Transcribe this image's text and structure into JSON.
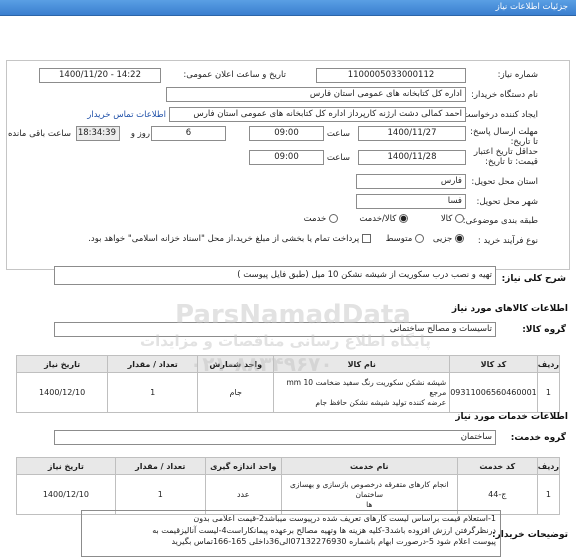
{
  "header": {
    "title": "جزئیات اطلاعات نیاز"
  },
  "form": {
    "need_number_label": "شماره نیاز:",
    "need_number": "1100005033000112",
    "announce_label": "تاریخ و ساعت اعلان عمومی:",
    "announce_value": "1400/11/20 - 14:22",
    "buyer_org_label": "نام دستگاه خریدار:",
    "buyer_org": "اداره کل کتابخانه های عمومی استان فارس",
    "creator_label": "ایجاد کننده درخواست:",
    "creator": "احمد  کمالی دشت ارژنه  کارپرداز اداره کل کتابخانه های عمومی استان فارس",
    "contact_link": "اطلاعات تماس خریدار",
    "deadline_label": "مهلت ارسال پاسخ: تا تاریخ:",
    "deadline_date": "1400/11/27",
    "time_label": "ساعت",
    "deadline_time": "09:00",
    "days": "6",
    "days_label": "روز و",
    "remaining_time": "18:34:39",
    "remaining_label": "ساعت باقی مانده",
    "price_valid_label": "حداقل تاریخ اعتبار قیمت: تا تاریخ:",
    "price_valid_date": "1400/11/28",
    "price_valid_time": "09:00",
    "province_label": "استان محل تحویل:",
    "province": "فارس",
    "city_label": "شهر محل تحویل:",
    "city": "فسا",
    "category_label": "طبقه بندی موضوعی:",
    "category_options": [
      "کالا",
      "کالا/خدمت",
      "خدمت"
    ],
    "purchase_label": "نوع فرآیند خرید :",
    "purchase_options": [
      "جزیی",
      "متوسط"
    ],
    "payment_note": "پرداخت تمام یا بخشی از مبلغ خرید،از محل \"اسناد خزانه اسلامی\" خواهد بود."
  },
  "summary": {
    "label": "شرح کلی نیاز:",
    "value": "تهیه و نصب درب سکوریت از شیشه نشکن 10 میل (طبق فایل پیوست )"
  },
  "goods": {
    "section_title": "اطلاعات کالاهای مورد نیاز",
    "group_label": "گروه کالا:",
    "group_value": "تاسیسات و مصالح ساختمانی",
    "headers": [
      "ردیف",
      "کد کالا",
      "نام کالا",
      "واحد شمارش",
      "تعداد / مقدار",
      "تاریخ نیاز"
    ],
    "rows": [
      {
        "row": "1",
        "code": "09311006560460001",
        "name_line1": "شیشه نشکن سکوریت رنگ سفید ضخامت 10 mm مرجع",
        "name_line2": "عرضه کننده تولید شیشه نشکن حافظ جام",
        "unit": "جام",
        "qty": "1",
        "date": "1400/12/10"
      }
    ]
  },
  "services": {
    "section_title": "اطلاعات خدمات مورد نیاز",
    "group_label": "گروه خدمت:",
    "group_value": "ساختمان",
    "headers": [
      "ردیف",
      "کد خدمت",
      "نام خدمت",
      "واحد اندازه گیری",
      "تعداد / مقدار",
      "تاریخ نیاز"
    ],
    "rows": [
      {
        "row": "1",
        "code": "ج-44",
        "name_line1": "انجام کارهای متفرقه درخصوص بازسازی و بهسازی ساختمان",
        "name_line2": "ها",
        "unit": "عدد",
        "qty": "1",
        "date": "1400/12/10"
      }
    ]
  },
  "notes": {
    "label": "توضیحات خریدار:",
    "line1": "1-استعلام قیمت براساس لیست کارهای تعریف شده درپیوست میباشد2-قیمت اعلامی بدون",
    "line2": "درنظرگرفتن ارزش افزوده باشد3-کلیه هزینه ها وتهیه مصالح برعهده پیمانکاراست4-لیست آنالیزقیمت به",
    "line3": "پیوست اعلام شود 5-درصورت ابهام باشماره 07132276930الی36داخلی 165-166تماس بگیرید"
  },
  "watermark": {
    "main": "ParsNamadData",
    "sub": "پایگاه اطلاع رسانی مناقصات و مزایدات",
    "phone": "۰۲۱-۸۸۳۴۹۶۷۰"
  },
  "colors": {
    "header_blue": "#3a7fcf",
    "link_blue": "#1e4fa8",
    "table_header": "#e8e8e8"
  }
}
